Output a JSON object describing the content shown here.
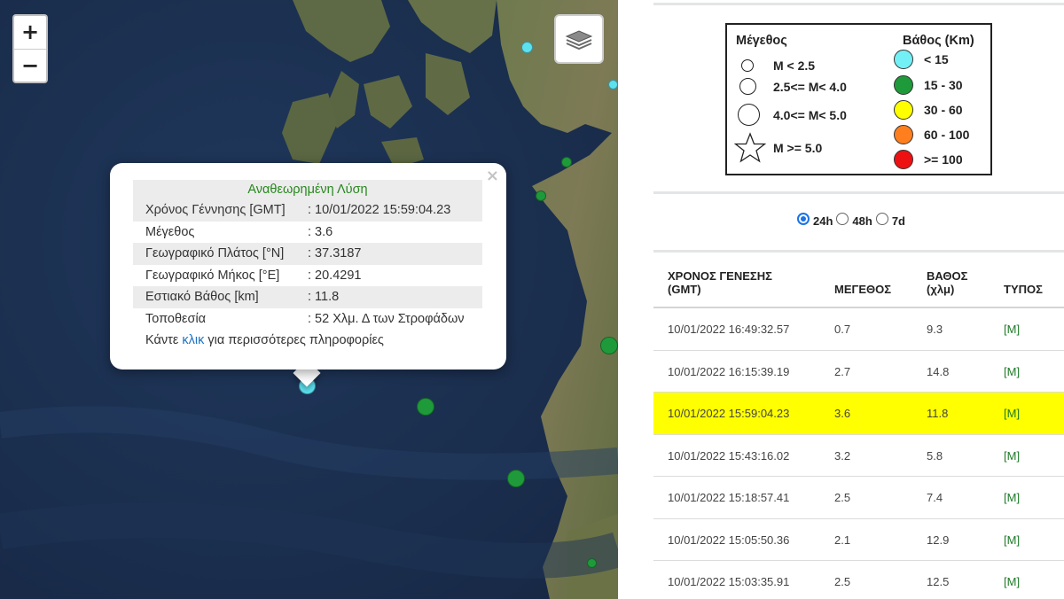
{
  "map": {
    "zoom_in_label": "+",
    "zoom_out_label": "−",
    "layers_icon": "layers-icon",
    "marker_colors": {
      "lt15": "#5ce1ef",
      "d15_30": "#1f9a3a"
    },
    "popup": {
      "title": "Αναθεωρημένη Λύση",
      "close_label": "×",
      "rows": [
        {
          "label": "Χρόνος Γέννησης [GMT]",
          "value": ": 10/01/2022 15:59:04.23"
        },
        {
          "label": "Μέγεθος",
          "value": ": 3.6"
        },
        {
          "label": "Γεωγραφικό Πλάτος [°N]",
          "value": ": 37.3187"
        },
        {
          "label": "Γεωγραφικό Μήκος [°E]",
          "value": ": 20.4291"
        },
        {
          "label": "Εστιακό Βάθος [km]",
          "value": ": 11.8"
        },
        {
          "label": "Τοποθεσία",
          "value": ": 52 Χλμ. Δ των Στροφάδων"
        }
      ],
      "footer_prefix": "Κάντε",
      "footer_link": "κλικ",
      "footer_suffix": "για περισσότερες πληροφορίες"
    }
  },
  "legend": {
    "magnitude_title": "Μέγεθος",
    "depth_title": "Βάθος (Km)",
    "magnitudes": [
      "M < 2.5",
      "2.5<= M< 4.0",
      "4.0<= M< 5.0",
      "M >= 5.0"
    ],
    "depths": [
      {
        "label": "< 15",
        "color": "#73f0f5"
      },
      {
        "label": "15 - 30",
        "color": "#1f9a3a"
      },
      {
        "label": "30 - 60",
        "color": "#ffff00"
      },
      {
        "label": "60 - 100",
        "color": "#ff7f1f"
      },
      {
        "label": ">= 100",
        "color": "#ee1111"
      }
    ]
  },
  "period": {
    "options": [
      "24h",
      "48h",
      "7d"
    ],
    "selected": "24h"
  },
  "table": {
    "headers": {
      "time_line1": "ΧΡΟΝΟΣ ΓΕΝΕΣΗΣ",
      "time_line2": "(GMT)",
      "magnitude": "ΜΕΓΕΘΟΣ",
      "depth_line1": "ΒΑΘΟΣ",
      "depth_line2": "(χλμ)",
      "type": "ΤΥΠΟΣ"
    },
    "highlight_color": "#ffff00",
    "rows": [
      {
        "time": "10/01/2022 16:49:32.57",
        "mag": "0.7",
        "depth": "9.3",
        "type": "[M]"
      },
      {
        "time": "10/01/2022 16:15:39.19",
        "mag": "2.7",
        "depth": "14.8",
        "type": "[M]"
      },
      {
        "time": "10/01/2022 15:59:04.23",
        "mag": "3.6",
        "depth": "11.8",
        "type": "[M]"
      },
      {
        "time": "10/01/2022 15:43:16.02",
        "mag": "3.2",
        "depth": "5.8",
        "type": "[M]"
      },
      {
        "time": "10/01/2022 15:18:57.41",
        "mag": "2.5",
        "depth": "7.4",
        "type": "[M]"
      },
      {
        "time": "10/01/2022 15:05:50.36",
        "mag": "2.1",
        "depth": "12.9",
        "type": "[M]"
      },
      {
        "time": "10/01/2022 15:03:35.91",
        "mag": "2.5",
        "depth": "12.5",
        "type": "[M]"
      }
    ]
  }
}
